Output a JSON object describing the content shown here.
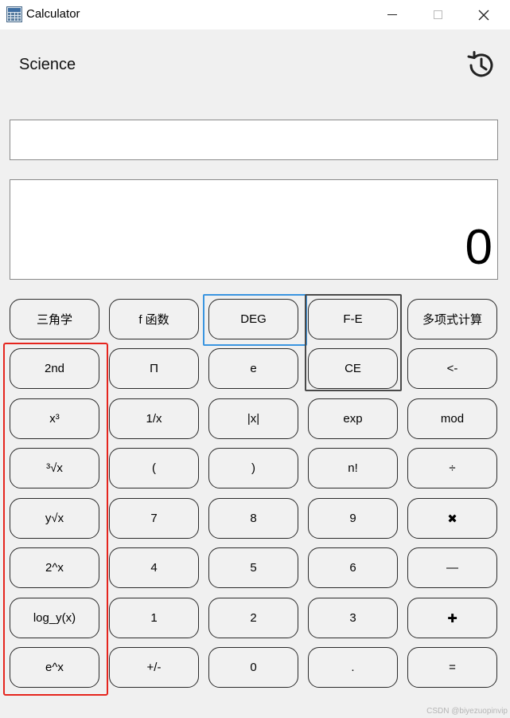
{
  "window": {
    "title": "Calculator",
    "minimize": "—",
    "close": "✕"
  },
  "header": {
    "mode": "Science",
    "history_icon": "history-clock-icon"
  },
  "display": {
    "expression": "",
    "result": "0"
  },
  "buttons": [
    [
      "三角学",
      "f 函数",
      "DEG",
      "F-E",
      "多项式计算"
    ],
    [
      "2nd",
      "Π",
      "e",
      "CE",
      "<-"
    ],
    [
      "x³",
      "1/x",
      "|x|",
      "exp",
      "mod"
    ],
    [
      "³√x",
      "(",
      ")",
      "n!",
      "÷"
    ],
    [
      "y√x",
      "7",
      "8",
      "9",
      "✖"
    ],
    [
      "2^x",
      "4",
      "5",
      "6",
      "—"
    ],
    [
      "log_y(x)",
      "1",
      "2",
      "3",
      "✚"
    ],
    [
      "e^x",
      "+/-",
      "0",
      ".",
      "="
    ]
  ],
  "highlight_colors": {
    "red": "#e5251e",
    "blue": "#3a95e0",
    "gray": "#4a4a4a"
  },
  "watermark": "CSDN @biyezuopinvip"
}
